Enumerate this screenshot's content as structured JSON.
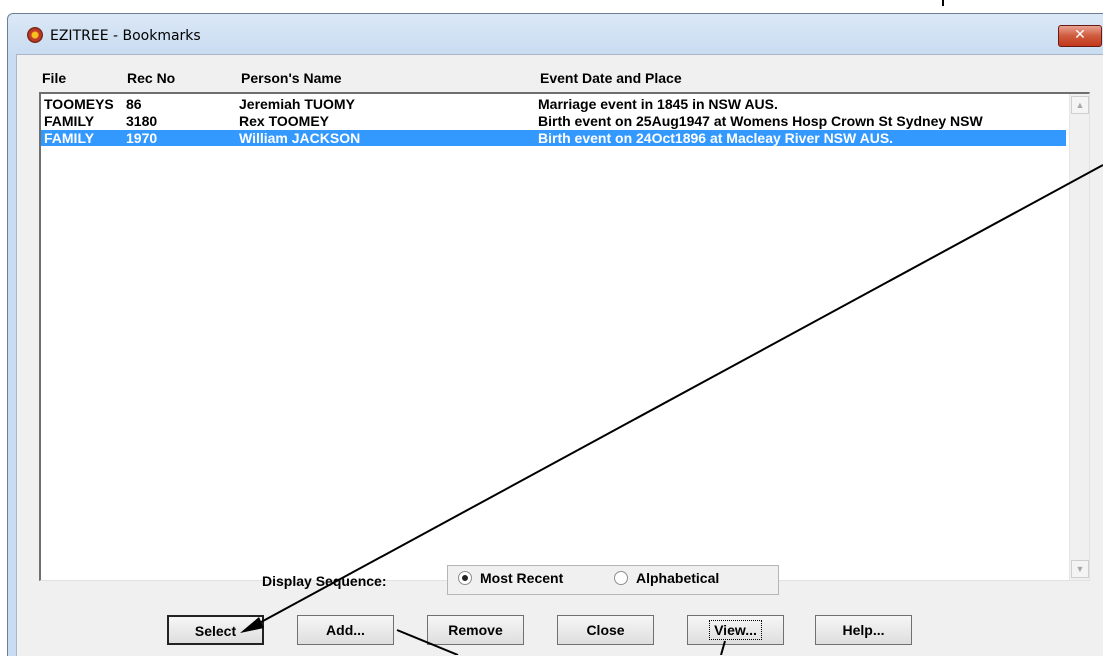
{
  "window": {
    "title": "EZITREE - Bookmarks",
    "close_glyph": "✕"
  },
  "columns": {
    "file": "File",
    "rec_no": "Rec No",
    "person": "Person's Name",
    "event": "Event Date and Place"
  },
  "rows": [
    {
      "file": "TOOMEYS",
      "rec_no": "86",
      "person": "Jeremiah TUOMY",
      "event": "Marriage event in 1845 in NSW AUS.",
      "selected": false
    },
    {
      "file": "FAMILY",
      "rec_no": "3180",
      "person": "Rex TOOMEY",
      "event": "Birth event on 25Aug1947 at Womens Hosp Crown St Sydney NSW",
      "selected": false
    },
    {
      "file": "FAMILY",
      "rec_no": "1970",
      "person": "William JACKSON",
      "event": "Birth event on 24Oct1896 at Macleay River NSW AUS.",
      "selected": true
    }
  ],
  "display_sequence": {
    "label": "Display Sequence:",
    "options": [
      "Most Recent",
      "Alphabetical"
    ],
    "selected": "Most Recent"
  },
  "buttons": {
    "select": "Select",
    "add": "Add...",
    "remove": "Remove",
    "close": "Close",
    "view": "View...",
    "help": "Help..."
  },
  "scrollbar": {
    "up_glyph": "▲",
    "down_glyph": "▼"
  },
  "colors": {
    "selection": "#3399ff",
    "title_close": "#c2391f"
  }
}
